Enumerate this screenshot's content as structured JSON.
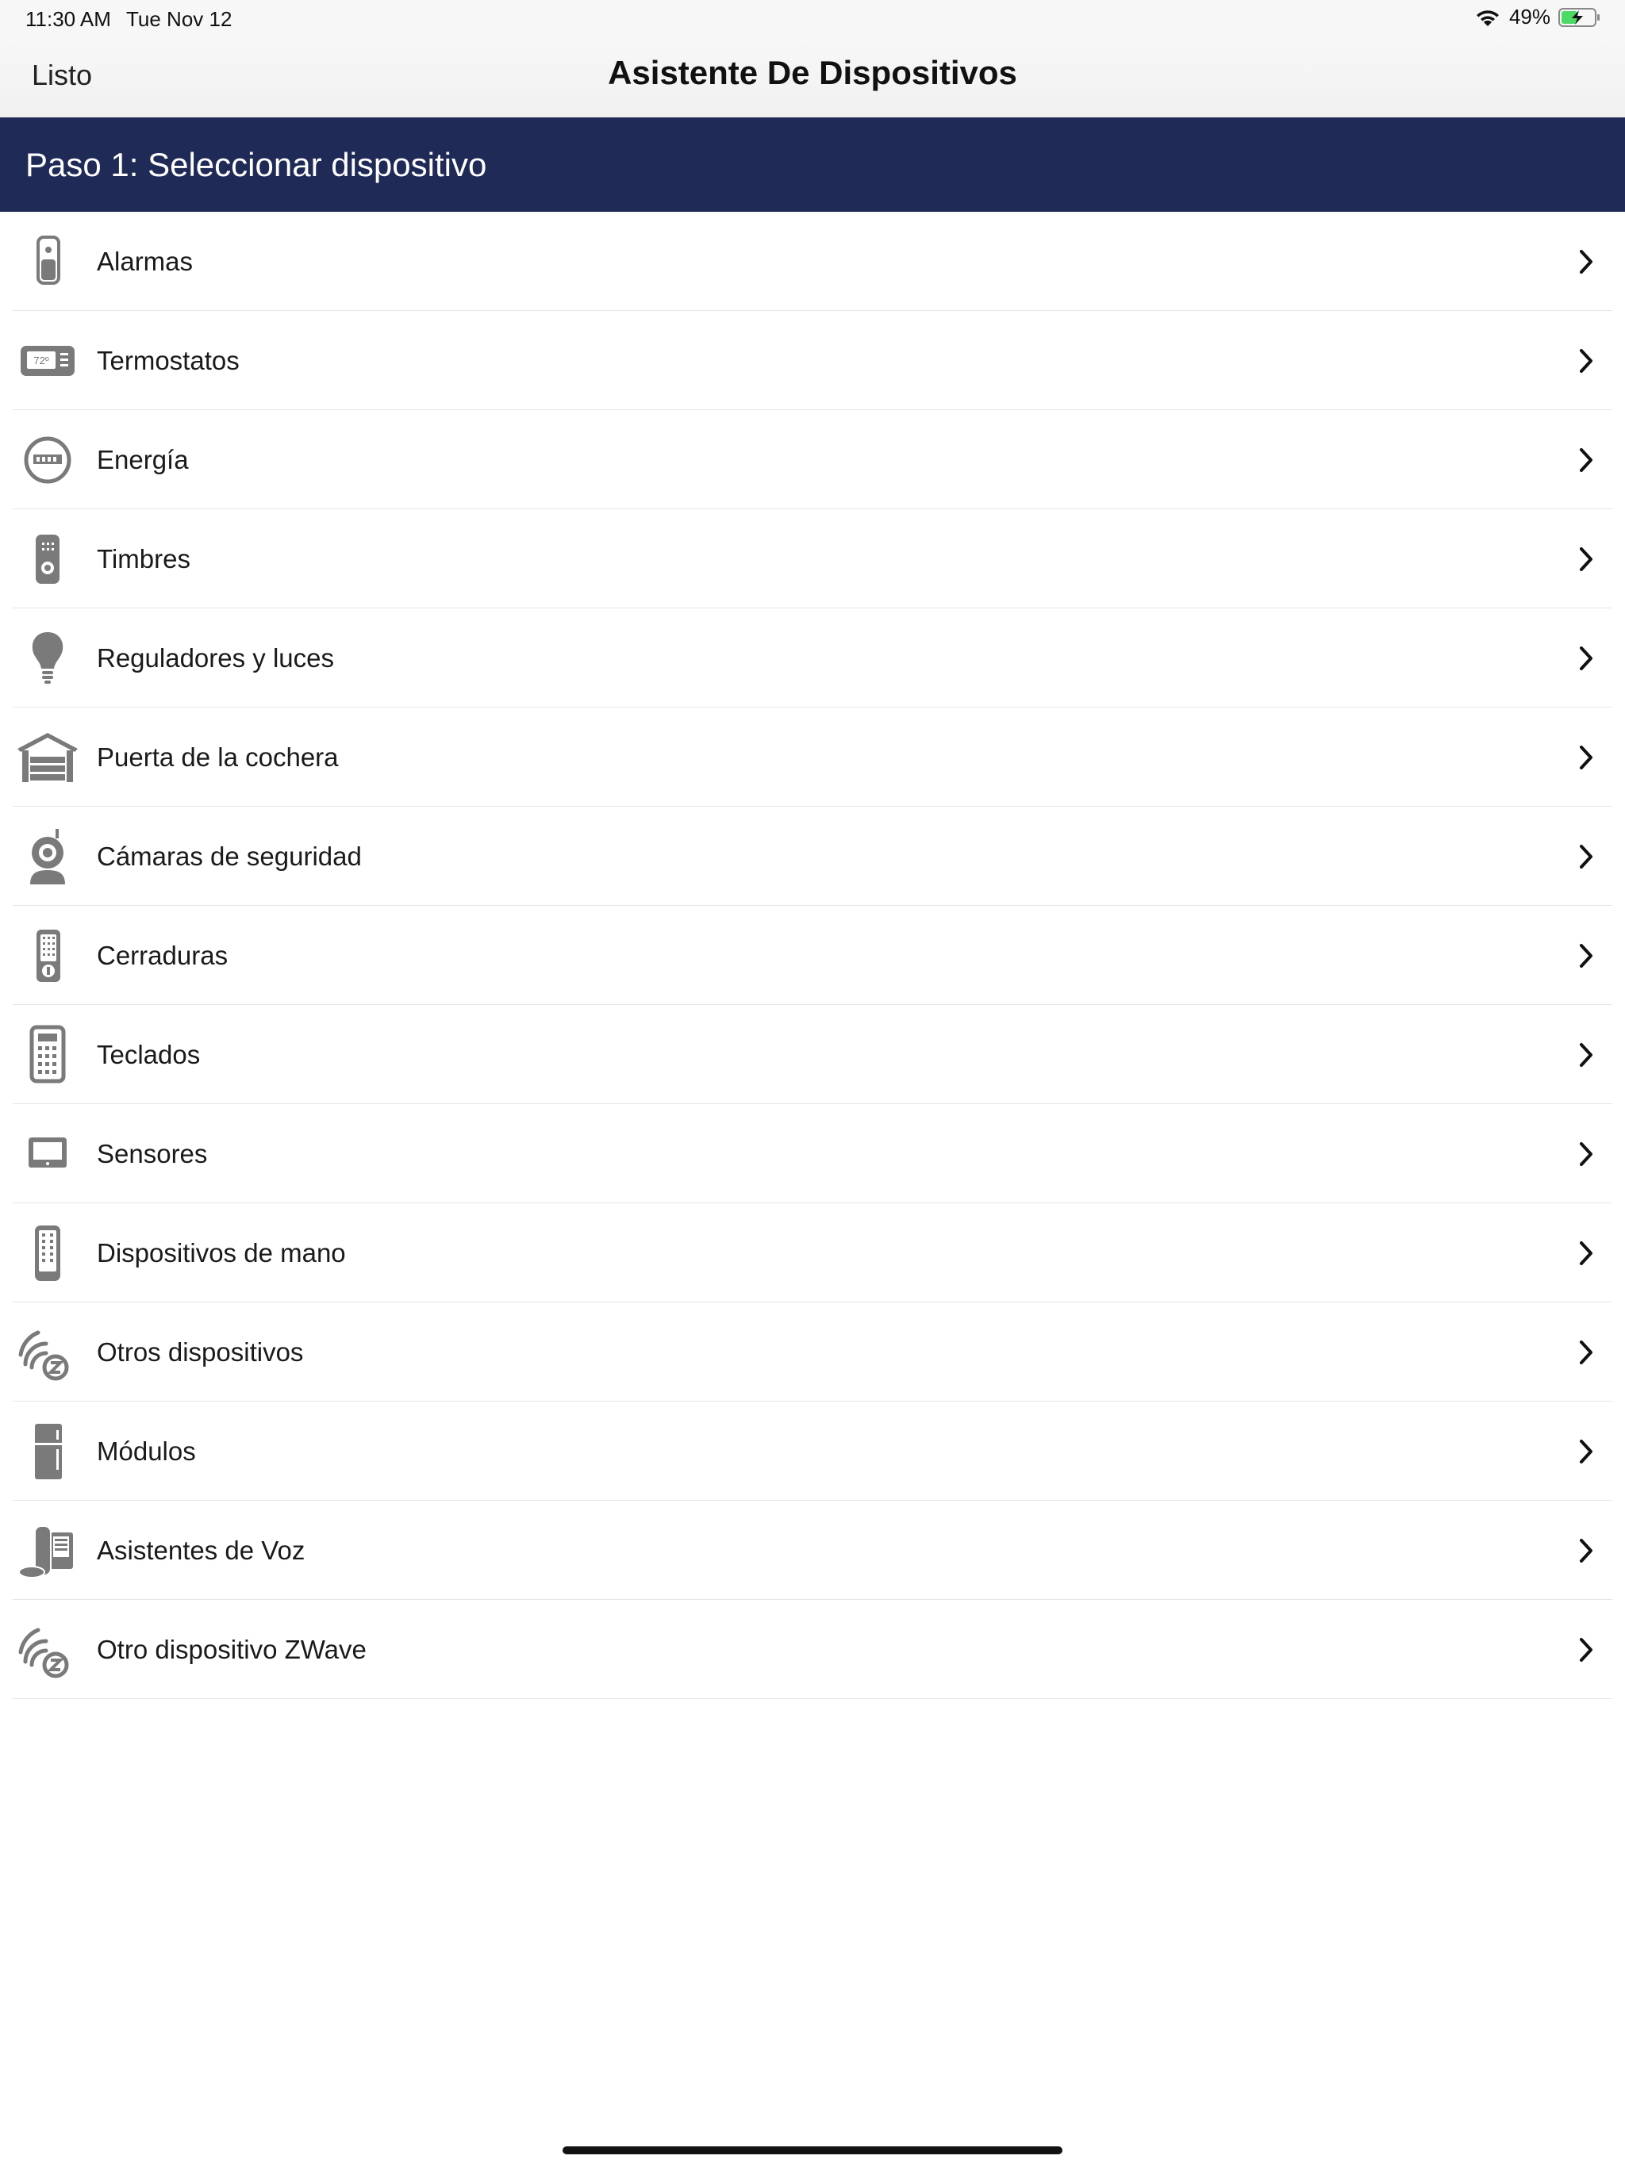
{
  "status_bar": {
    "time": "11:30 AM",
    "date": "Tue Nov 12",
    "battery": "49%",
    "battery_level": 0.49,
    "icons": [
      "wifi-icon",
      "battery-charging-icon"
    ]
  },
  "nav": {
    "done_label": "Listo",
    "title": "Asistente De Dispositivos"
  },
  "step": {
    "title": "Paso 1: Seleccionar dispositivo"
  },
  "colors": {
    "header_bg": "#1f2a57",
    "icon_gray": "#7a7a7a",
    "battery_green": "#4cd964"
  },
  "devices": [
    {
      "label": "Alarmas",
      "icon": "alarm-keypad-icon"
    },
    {
      "label": "Termostatos",
      "icon": "thermostat-icon",
      "icon_text": "72º"
    },
    {
      "label": "Energía",
      "icon": "energy-meter-icon"
    },
    {
      "label": "Timbres",
      "icon": "doorbell-icon"
    },
    {
      "label": "Reguladores y luces",
      "icon": "light-bulb-icon"
    },
    {
      "label": "Puerta de la cochera",
      "icon": "garage-door-icon"
    },
    {
      "label": "Cámaras de seguridad",
      "icon": "security-camera-icon"
    },
    {
      "label": "Cerraduras",
      "icon": "door-lock-icon"
    },
    {
      "label": "Teclados",
      "icon": "keypad-icon"
    },
    {
      "label": "Sensores",
      "icon": "sensor-icon"
    },
    {
      "label": "Dispositivos de mano",
      "icon": "handheld-remote-icon"
    },
    {
      "label": "Otros dispositivos",
      "icon": "zwave-icon"
    },
    {
      "label": "Módulos",
      "icon": "refrigerator-module-icon"
    },
    {
      "label": "Asistentes de Voz",
      "icon": "voice-assistant-icon"
    },
    {
      "label": "Otro dispositivo ZWave",
      "icon": "zwave-icon"
    }
  ]
}
